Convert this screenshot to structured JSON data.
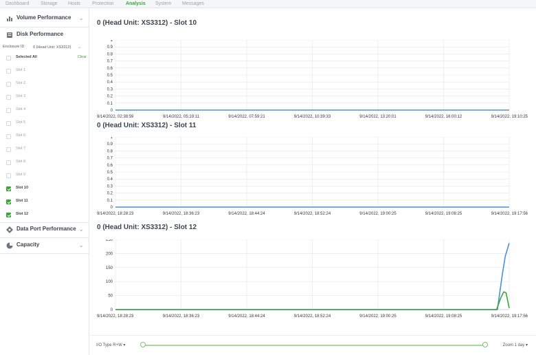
{
  "nav": {
    "tabs": [
      {
        "label": "Dashboard",
        "active": false
      },
      {
        "label": "Storage",
        "active": false
      },
      {
        "label": "Hosts",
        "active": false
      },
      {
        "label": "Protection",
        "active": false
      },
      {
        "label": "Analysis",
        "active": true
      },
      {
        "label": "System",
        "active": false
      },
      {
        "label": "Messages",
        "active": false
      }
    ]
  },
  "sidebar": {
    "volume_performance": "Volume Performance",
    "disk_performance": "Disk Performance",
    "enclosure_label": "Enclosure ID",
    "enclosure_value": "0 (Head Unit: XS3312)",
    "selected_all": "Selected All",
    "clear": "Clear",
    "slots": [
      {
        "label": "Slot 1",
        "checked": false
      },
      {
        "label": "Slot 2",
        "checked": false
      },
      {
        "label": "Slot 3",
        "checked": false
      },
      {
        "label": "Slot 4",
        "checked": false
      },
      {
        "label": "Slot 5",
        "checked": false
      },
      {
        "label": "Slot 6",
        "checked": false
      },
      {
        "label": "Slot 7",
        "checked": false
      },
      {
        "label": "Slot 8",
        "checked": false
      },
      {
        "label": "Slot 9",
        "checked": false
      },
      {
        "label": "Slot 10",
        "checked": true
      },
      {
        "label": "Slot 11",
        "checked": true
      },
      {
        "label": "Slot 12",
        "checked": true
      }
    ],
    "data_port_performance": "Data Port Performance",
    "capacity": "Capacity"
  },
  "footer": {
    "io_type": "I/O Type R+W",
    "zoom": "Zoom 1 day"
  },
  "colors": {
    "accent": "#3aa63a",
    "series_blue": "#4a90d9",
    "series_green": "#3aa63a"
  },
  "chart_data": [
    {
      "type": "line",
      "title": "0 (Head Unit: XS3312) - Slot 10",
      "ylim": [
        0,
        1
      ],
      "yticks": [
        "0",
        "0.1",
        "0.2",
        "0.3",
        "0.4",
        "0.5",
        "0.6",
        "0.7",
        "0.8",
        "0.9",
        "1"
      ],
      "xticks": [
        "9/14/2022, 02:38:59",
        "9/14/2022, 05:19:11",
        "9/14/2022, 07:59:21",
        "9/14/2022, 10:39:33",
        "9/14/2022, 13:20:01",
        "9/14/2022, 16:00:12",
        "9/14/2022, 19:10:25"
      ],
      "series": [
        {
          "color": "#4a90d9",
          "values": [
            0,
            0,
            0,
            0,
            0,
            0,
            0
          ]
        }
      ]
    },
    {
      "type": "line",
      "title": "0 (Head Unit: XS3312) - Slot 11",
      "ylim": [
        0,
        1
      ],
      "yticks": [
        "0",
        "0.1",
        "0.2",
        "0.3",
        "0.4",
        "0.5",
        "0.6",
        "0.7",
        "0.8",
        "0.9",
        "1"
      ],
      "xticks": [
        "9/14/2022, 18:28:23",
        "9/14/2022, 18:36:23",
        "9/14/2022, 18:44:24",
        "9/14/2022, 18:52:24",
        "9/14/2022, 19:00:25",
        "9/14/2022, 19:08:25",
        "9/14/2022, 19:17:56"
      ],
      "series": [
        {
          "color": "#4a90d9",
          "values": [
            0,
            0,
            0,
            0,
            0,
            0,
            0
          ]
        }
      ]
    },
    {
      "type": "line",
      "title": "0 (Head Unit: XS3312) - Slot 12",
      "ylim": [
        0,
        250
      ],
      "yticks": [
        "0",
        "50",
        "100",
        "150",
        "200",
        "250"
      ],
      "xticks": [
        "9/14/2022, 18:28:23",
        "9/14/2022, 18:36:23",
        "9/14/2022, 18:44:24",
        "9/14/2022, 18:52:24",
        "9/14/2022, 19:00:25",
        "9/14/2022, 19:08:25",
        "9/14/2022, 19:17:56"
      ],
      "series": [
        {
          "color": "#4a90d9",
          "points": [
            [
              0,
              0
            ],
            [
              0.97,
              0
            ],
            [
              0.982,
              120
            ],
            [
              0.99,
              190
            ],
            [
              1.0,
              237
            ]
          ]
        },
        {
          "color": "#3aa63a",
          "points": [
            [
              0,
              0
            ],
            [
              0.968,
              0
            ],
            [
              0.978,
              40
            ],
            [
              0.986,
              63
            ],
            [
              0.992,
              60
            ],
            [
              1.0,
              5
            ]
          ]
        }
      ]
    }
  ]
}
